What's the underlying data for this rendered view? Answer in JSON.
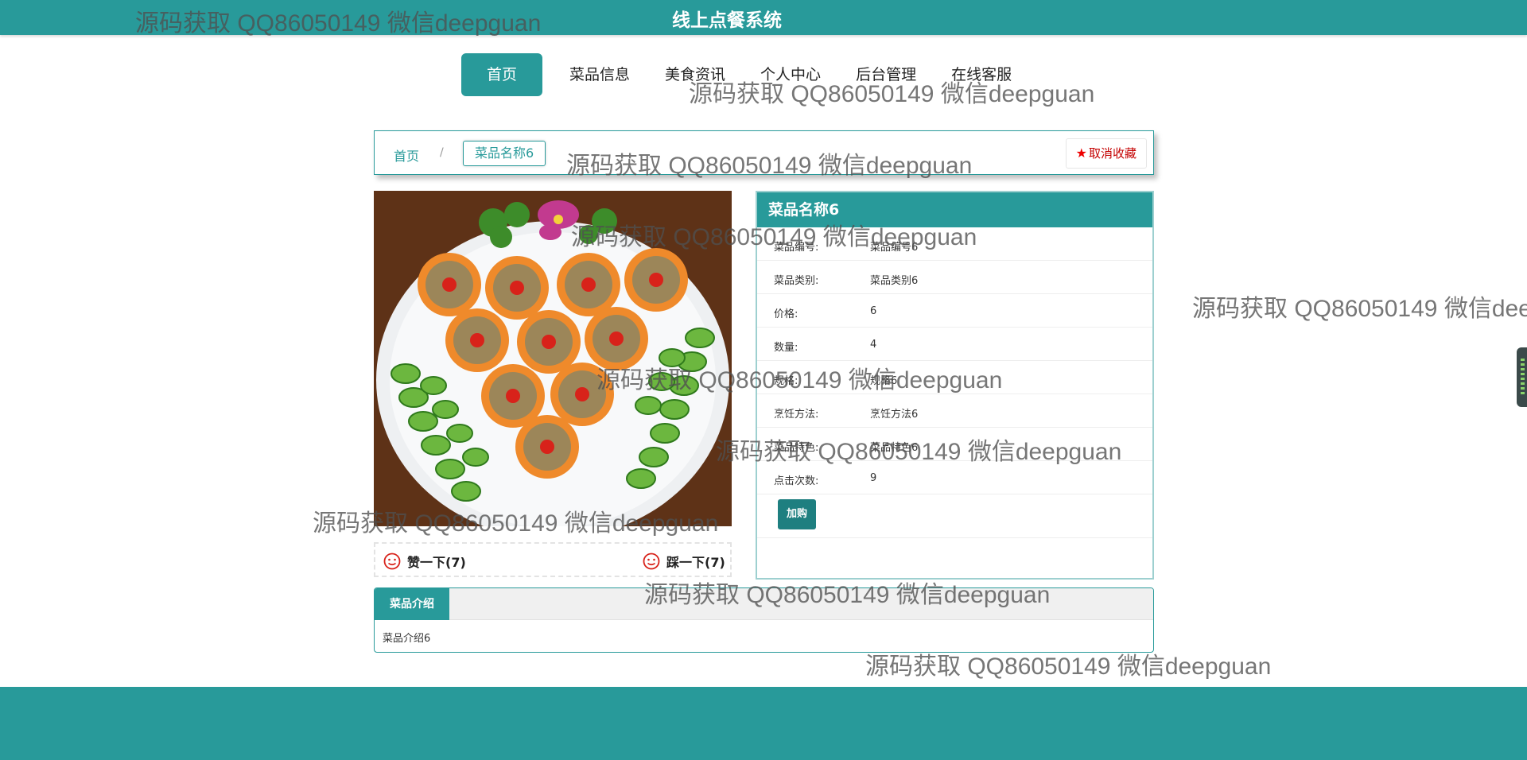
{
  "header": {
    "title": "线上点餐系统"
  },
  "nav": {
    "items": [
      {
        "label": "首页",
        "active": true
      },
      {
        "label": "菜品信息"
      },
      {
        "label": "美食资讯"
      },
      {
        "label": "个人中心"
      },
      {
        "label": "后台管理"
      },
      {
        "label": "在线客服"
      }
    ]
  },
  "breadcrumb": {
    "home": "首页",
    "separator": "/",
    "current": "菜品名称6"
  },
  "favorite": {
    "label": "取消收藏",
    "icon": "star-icon"
  },
  "detail": {
    "title": "菜品名称6",
    "fields": [
      {
        "label": "菜品编号:",
        "value": "菜品编号6"
      },
      {
        "label": "菜品类别:",
        "value": "菜品类别6"
      },
      {
        "label": "价格:",
        "value": "6"
      },
      {
        "label": "数量:",
        "value": "4"
      },
      {
        "label": "规格:",
        "value": "规格6"
      },
      {
        "label": "烹饪方法:",
        "value": "烹饪方法6"
      },
      {
        "label": "菜品特色:",
        "value": "菜品特色6"
      },
      {
        "label": "点击次数:",
        "value": "9"
      }
    ],
    "buy_label": "加购"
  },
  "votes": {
    "like": "赞一下(7)",
    "dislike": "踩一下(7)"
  },
  "intro": {
    "tab": "菜品介绍",
    "content": "菜品介绍6"
  },
  "watermark": "源码获取 QQ86050149 微信deepguan",
  "colors": {
    "primary": "#289a9a",
    "button_dark": "#1e7f80",
    "favorite_red": "#c40000"
  }
}
